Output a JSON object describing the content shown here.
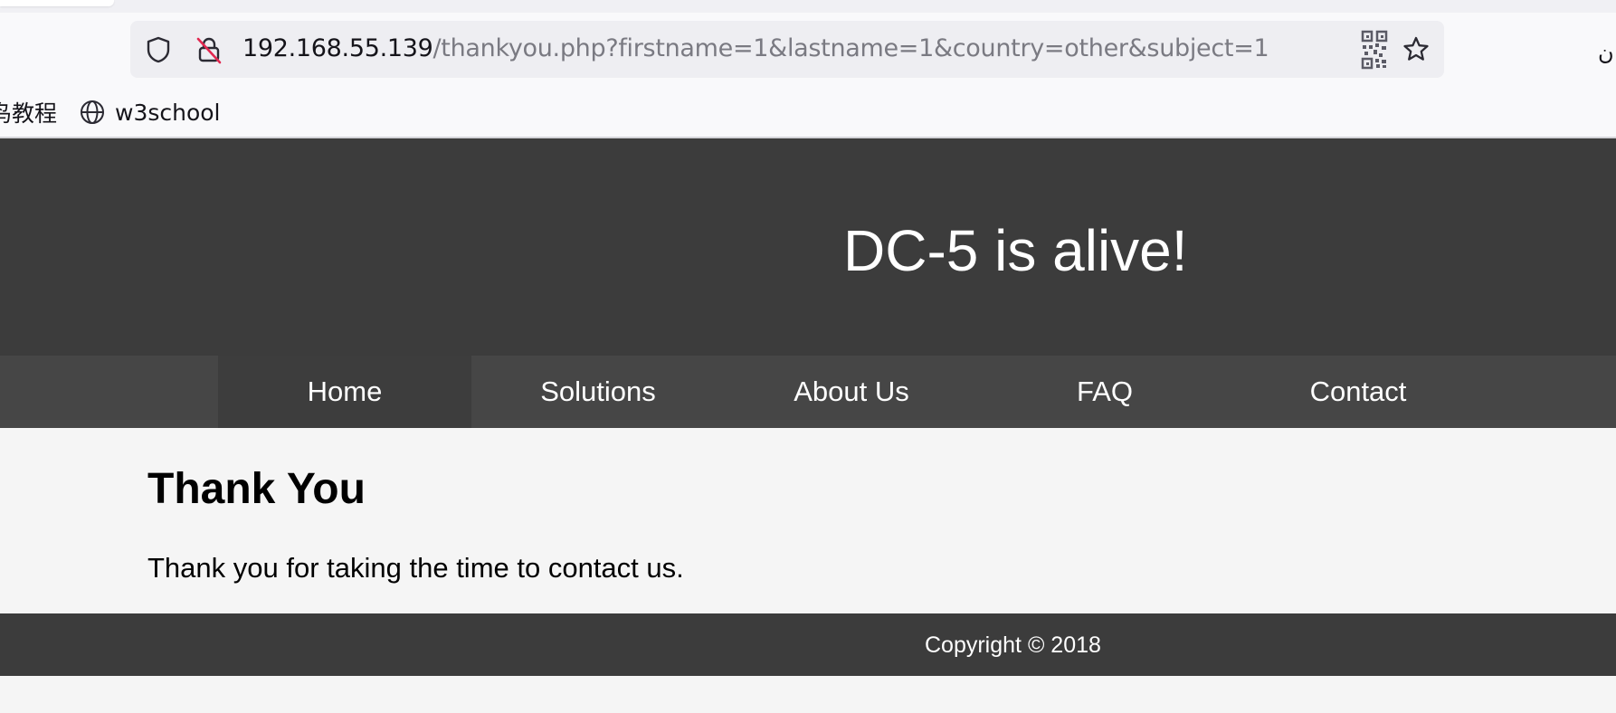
{
  "browser": {
    "url_host": "192.168.55.139",
    "url_path": "/thankyou.php?firstname=1&lastname=1&country=other&subject=1",
    "bookmarks": [
      {
        "label": "鸟教程",
        "icon": "none"
      },
      {
        "label": "w3school",
        "icon": "globe-icon"
      }
    ],
    "icons": [
      "shield-icon",
      "insecure-lock-icon",
      "qr-code-icon",
      "star-bookmark-icon"
    ],
    "edge_glyph": "ن",
    "accent_insecure": "#e22850"
  },
  "page": {
    "header": {
      "title": "DC-5 is alive!"
    },
    "nav": {
      "items": [
        {
          "label": "Home",
          "active": true
        },
        {
          "label": "Solutions",
          "active": false
        },
        {
          "label": "About Us",
          "active": false
        },
        {
          "label": "FAQ",
          "active": false
        },
        {
          "label": "Contact",
          "active": false
        }
      ]
    },
    "content": {
      "heading": "Thank You",
      "message": "Thank you for taking the time to contact us."
    },
    "footer": {
      "copyright": "Copyright © 2018"
    },
    "colors": {
      "header_bg": "#3c3c3c",
      "nav_bg": "#464646",
      "nav_active_bg": "#3d3d3d",
      "content_bg": "#f5f5f5"
    }
  }
}
